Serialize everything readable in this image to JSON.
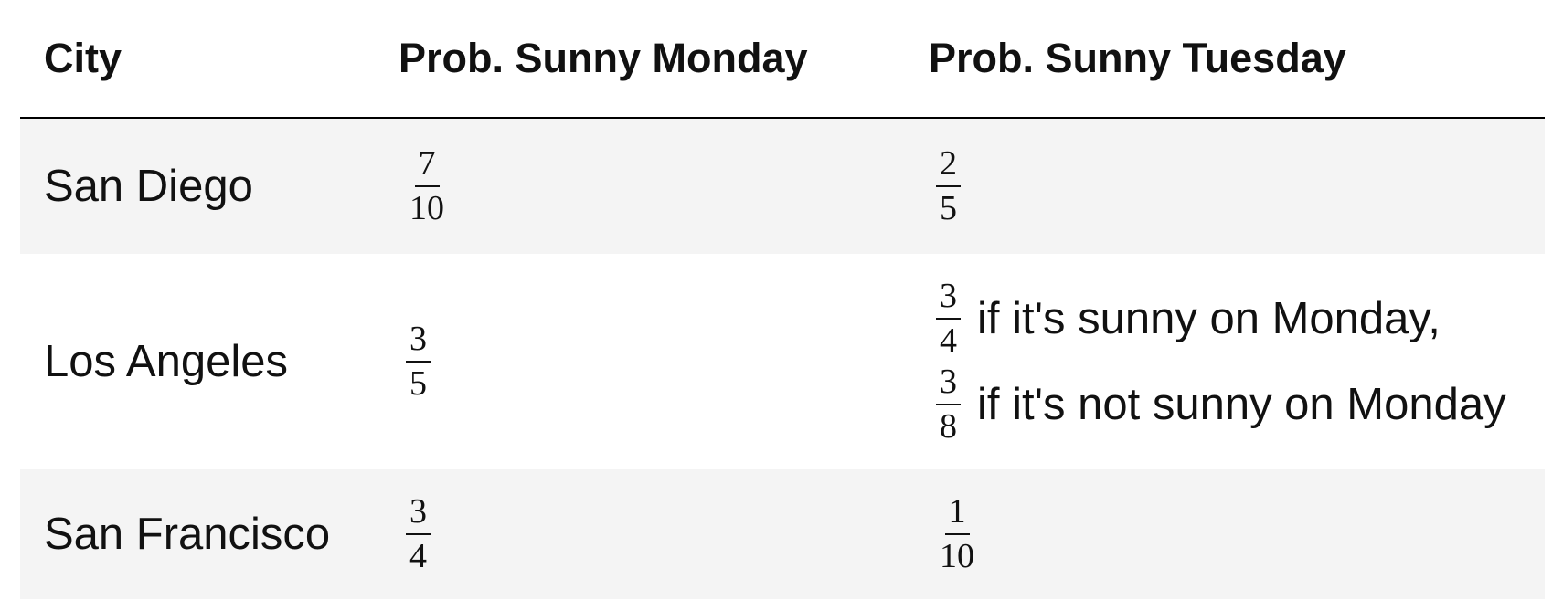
{
  "table": {
    "headers": {
      "city": "City",
      "monday": "Prob. Sunny Monday",
      "tuesday": "Prob. Sunny Tuesday"
    },
    "rows": [
      {
        "city": "San Diego",
        "monday": {
          "num": "7",
          "den": "10"
        },
        "tuesday": {
          "num": "2",
          "den": "5"
        }
      },
      {
        "city": "Los Angeles",
        "monday": {
          "num": "3",
          "den": "5"
        },
        "tuesday_conditional": [
          {
            "num": "3",
            "den": "4",
            "text": "if it's sunny on Monday,"
          },
          {
            "num": "3",
            "den": "8",
            "text": "if it's not sunny on Monday"
          }
        ]
      },
      {
        "city": "San Francisco",
        "monday": {
          "num": "3",
          "den": "4"
        },
        "tuesday": {
          "num": "1",
          "den": "10"
        }
      }
    ]
  }
}
